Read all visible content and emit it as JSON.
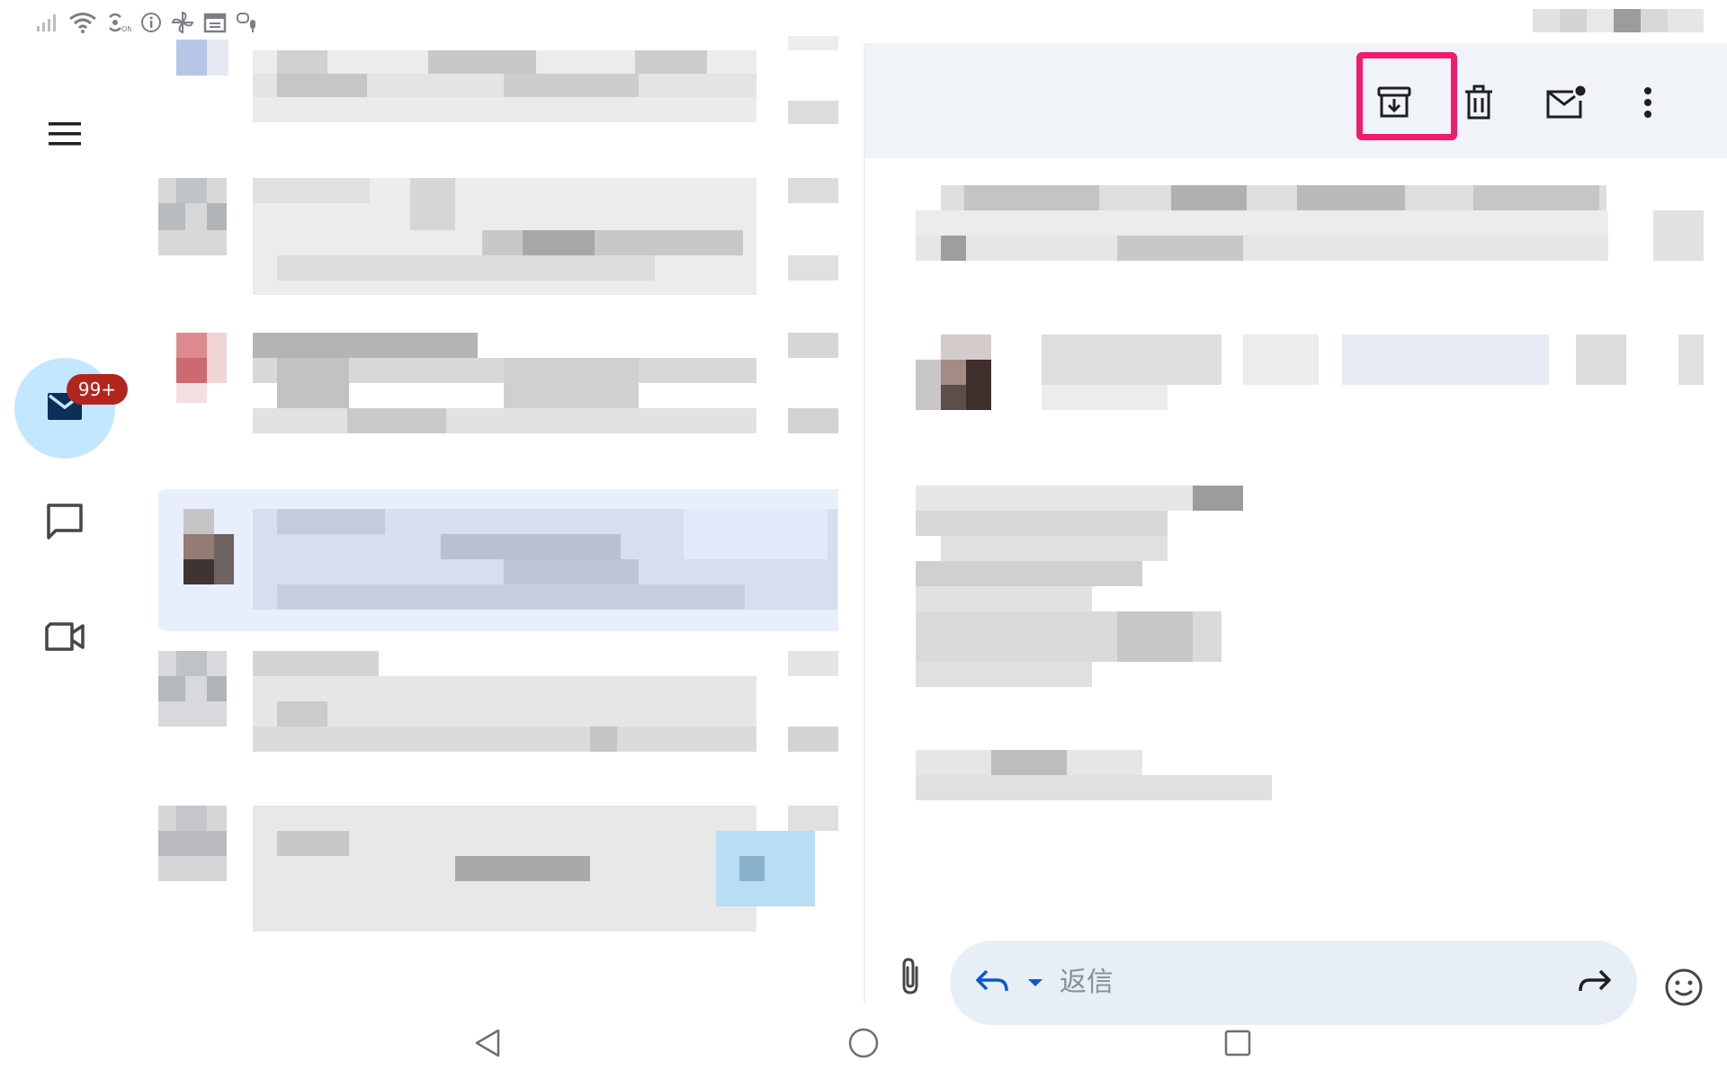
{
  "app": {
    "accent": "#c2e7ff",
    "badge_color": "#b3261e",
    "highlight_color": "#f21c6e"
  },
  "status_bar": {
    "icons": [
      "signal-icon",
      "wifi-icon",
      "hotspot-icon",
      "info-icon",
      "pinwheel-icon",
      "calendar-icon",
      "mic-icon"
    ]
  },
  "nav_rail": {
    "items": [
      {
        "name": "menu",
        "icon": "menu-icon"
      },
      {
        "name": "mail",
        "icon": "mail-icon",
        "badge": "99+",
        "active": true
      },
      {
        "name": "chat",
        "icon": "chat-icon"
      },
      {
        "name": "meet",
        "icon": "video-icon"
      }
    ]
  },
  "toolbar": {
    "buttons": [
      {
        "name": "archive",
        "icon": "archive-icon",
        "highlighted": true
      },
      {
        "name": "delete",
        "icon": "trash-icon"
      },
      {
        "name": "mark-unread",
        "icon": "mark-unread-icon"
      },
      {
        "name": "more",
        "icon": "more-vert-icon"
      }
    ]
  },
  "reply_bar": {
    "reply_label": "返信",
    "icons": [
      "attach-icon",
      "reply-icon",
      "dropdown-icon",
      "forward-icon",
      "emoji-icon"
    ]
  },
  "nav_bar": {
    "icons": [
      "back-icon",
      "home-icon",
      "recents-icon"
    ]
  }
}
